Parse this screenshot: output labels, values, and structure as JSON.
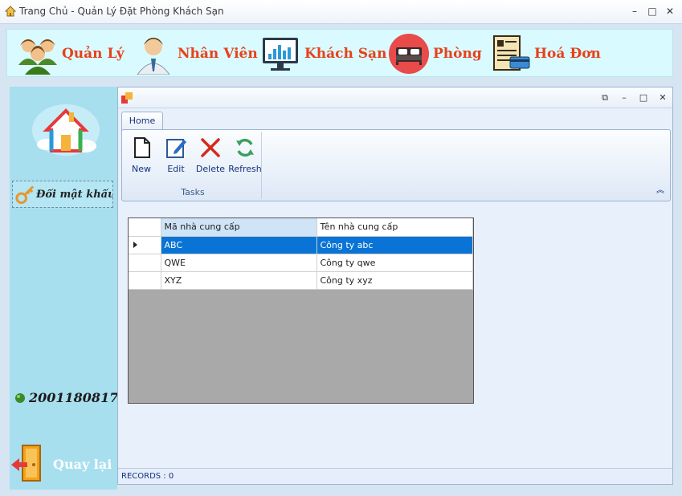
{
  "window": {
    "title": "Trang Chủ - Quản Lý Đặt Phòng Khách Sạn",
    "minimize": "–",
    "maximize": "□",
    "close": "✕"
  },
  "menu": [
    {
      "label": "Quản Lý",
      "icon": "users-group-icon"
    },
    {
      "label": "Nhân Viên",
      "icon": "employee-icon"
    },
    {
      "label": "Khách Sạn",
      "icon": "chart-monitor-icon"
    },
    {
      "label": "Phòng",
      "icon": "bed-icon"
    },
    {
      "label": "Hoá Đơn",
      "icon": "invoice-icon"
    }
  ],
  "sidebar": {
    "change_password": "Đổi mật khẩu",
    "user_id": "2001180817",
    "back": "Quay lại"
  },
  "child": {
    "minimize": "–",
    "restore": "□",
    "close": "✕",
    "ribbon": {
      "tab": "Home",
      "group": "Tasks",
      "buttons": {
        "new": "New",
        "edit": "Edit",
        "delete": "Delete",
        "refresh": "Refresh"
      }
    },
    "grid": {
      "columns": [
        "Mã nhà cung cấp",
        "Tên nhà cung cấp"
      ],
      "rows": [
        [
          "ABC",
          "Công ty abc"
        ],
        [
          "QWE",
          "Công ty qwe"
        ],
        [
          "XYZ",
          "Công ty xyz"
        ]
      ],
      "selected_row": 0
    },
    "status": "RECORDS : 0"
  },
  "colors": {
    "menu_label": "#e8411c",
    "sidebar_bg": "#a8dfef",
    "selected_row": "#0a74d6"
  }
}
